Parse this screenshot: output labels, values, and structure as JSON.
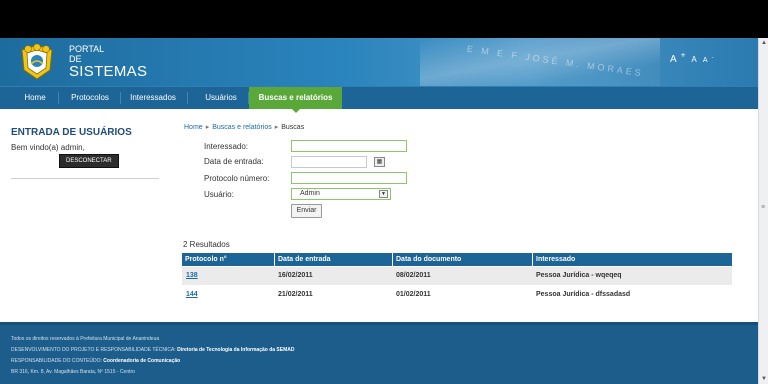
{
  "portal": {
    "line1": "PORTAL",
    "line2": "DE",
    "line3": "SISTEMAS",
    "logo_text": "P M A",
    "banner_text": "E M E F JOSÉ M. MORAES"
  },
  "font_controls": {
    "large": "A",
    "medium": "A",
    "small": "A",
    "plus": "+",
    "minus": "-"
  },
  "nav": {
    "items": [
      {
        "label": "Home"
      },
      {
        "label": "Protocolos"
      },
      {
        "label": "Interessados"
      },
      {
        "label": "Usuários"
      },
      {
        "label": "Buscas e relatórios"
      }
    ],
    "active_index": 4,
    "active_color": "#5aa83a",
    "bar_color": "#1c6596"
  },
  "sidebar": {
    "title": "ENTRADA DE USUÁRIOS",
    "welcome": "Bem vindo(a) admin,",
    "logout_label": "DESCONECTAR"
  },
  "breadcrumb": {
    "home": "Home",
    "section": "Buscas e relatórios",
    "current": "Buscas",
    "separator": "▸"
  },
  "form": {
    "interessado_label": "Interessado:",
    "interessado_value": "",
    "data_entrada_label": "Data de entrada:",
    "data_entrada_value": "",
    "protocolo_label": "Protocolo número:",
    "protocolo_value": "",
    "usuario_label": "Usuário:",
    "usuario_selected": "Admin",
    "submit_label": "Enviar"
  },
  "results": {
    "count_text": "2 Resultados",
    "columns": [
      "Protocolo n°",
      "Data de entrada",
      "Data do documento",
      "Interessado"
    ],
    "rows": [
      {
        "protocolo": "138",
        "data_entrada": "16/02/2011",
        "data_documento": "08/02/2011",
        "interessado": "Pessoa Jurídica - wqeqeq"
      },
      {
        "protocolo": "144",
        "data_entrada": "21/02/2011",
        "data_documento": "01/02/2011",
        "interessado": "Pessoa Jurídica - dfssadasd"
      }
    ]
  },
  "footer": {
    "line1": "Todos os direitos reservados à Prefeitura Municipal de Ananindeua",
    "line2_prefix": "DESENVOLVIMENTO DO PROJETO E RESPONSABILIDADE TÉCNICA: ",
    "line2_value": "Diretoria de Tecnologia da Informação da SEMAD",
    "line3_prefix": "RESPONSABILIDADE DO CONTEÚDO: ",
    "line3_value": "Coordenadoria de Comunicação",
    "line4": "BR 316, Km. 8, Av. Magalhães Barata, Nº 1515 - Centro"
  }
}
